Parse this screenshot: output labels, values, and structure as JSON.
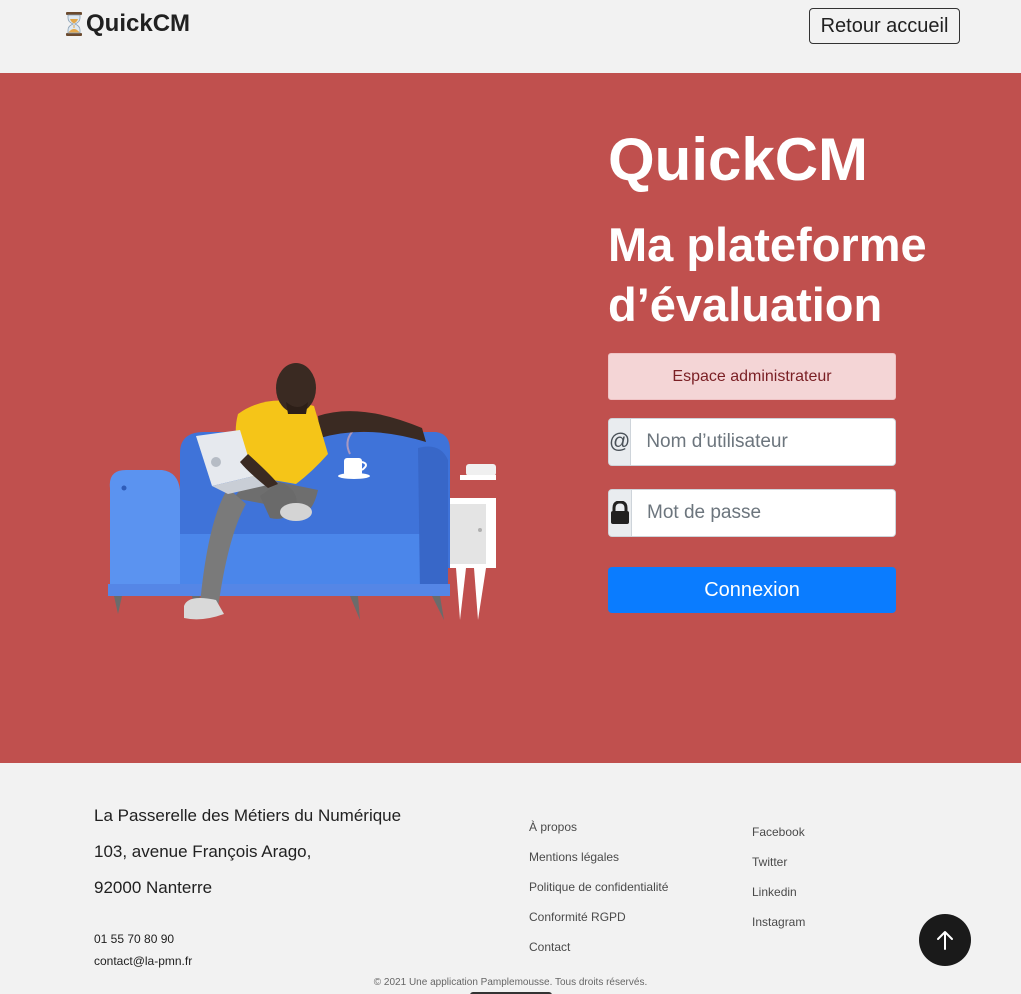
{
  "header": {
    "brand_name": "QuickCM",
    "home_button_label": "Retour accueil"
  },
  "hero": {
    "title": "QuickCM",
    "subtitle": "Ma plateforme d’évaluation",
    "admin_badge": "Espace administrateur",
    "username": {
      "addon_symbol": "@",
      "placeholder": "Nom d’utilisateur",
      "value": ""
    },
    "password": {
      "addon_icon": "lock-icon",
      "placeholder": "Mot de passe",
      "value": ""
    },
    "login_button_label": "Connexion"
  },
  "footer": {
    "address": [
      "La Passerelle des Métiers du Numérique",
      "103, avenue François Arago,",
      "92000 Nanterre"
    ],
    "phone": "01 55 70 80 90",
    "email": "contact@la-pmn.fr",
    "info_links": [
      "À propos",
      "Mentions légales",
      "Politique de confidentialité",
      "Conformité RGPD",
      "Contact"
    ],
    "social_links": [
      "Facebook",
      "Twitter",
      "Linkedin",
      "Instagram"
    ],
    "copyright": "© 2021 Une application Pamplemousse. Tous droits réservés."
  },
  "colors": {
    "hero_background": "#c0504e",
    "primary_button": "#0a7cff",
    "badge_background": "#f4d5d6",
    "badge_text": "#7a1f24"
  },
  "icons": {
    "brand": "hourglass-icon",
    "scroll_top": "arrow-up-icon"
  }
}
